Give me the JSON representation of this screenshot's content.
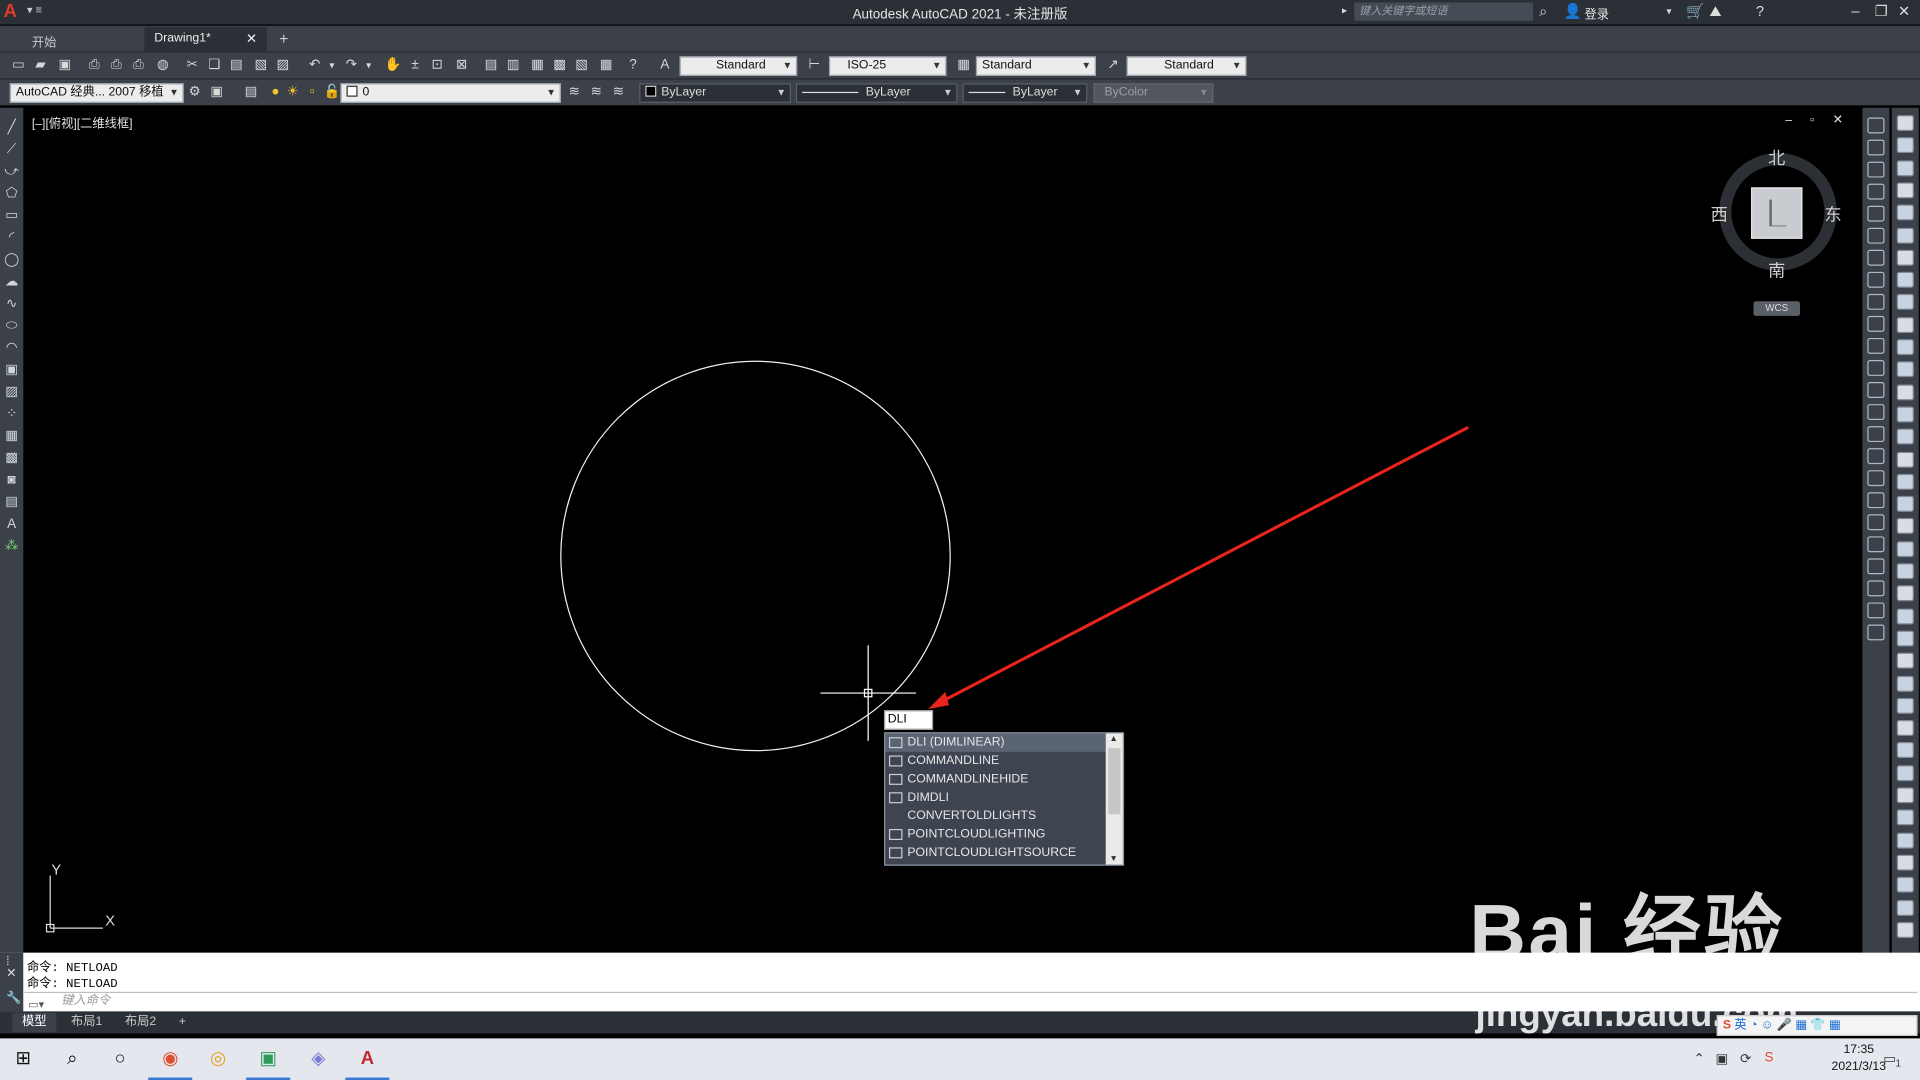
{
  "titlebar": {
    "title": "Autodesk AutoCAD 2021 - 未注册版",
    "search_placeholder": "键入关键字或短语",
    "login_label": "登录",
    "help_label": "?"
  },
  "doc_tabs": {
    "start_label": "开始",
    "drawing_label": "Drawing1*",
    "close_glyph": "✕",
    "add_glyph": "+"
  },
  "toolbar1": {
    "text_style": "Standard",
    "dim_style": "ISO-25",
    "table_style": "Standard",
    "mleader_style": "Standard"
  },
  "toolbar2": {
    "workspace": "AutoCAD 经典... 2007 移植",
    "layer": "0",
    "color": "ByLayer",
    "linetype": "ByLayer",
    "lineweight": "ByLayer",
    "plotstyle": "ByColor"
  },
  "viewport": {
    "label": "[–][俯视][二维线框]",
    "controls": "– ▫ ✕"
  },
  "viewcube": {
    "north": "北",
    "south": "南",
    "east": "东",
    "west": "西",
    "wcs": "WCS"
  },
  "ucs": {
    "y": "Y",
    "x": "X"
  },
  "command_input": {
    "value": "DLI"
  },
  "autocomplete": {
    "items": [
      {
        "label": "DLI (DIMLINEAR)",
        "icon": "dimlinear-icon"
      },
      {
        "label": "COMMANDLINE",
        "icon": "commandline-icon"
      },
      {
        "label": "COMMANDLINEHIDE",
        "icon": "commandlinehide-icon"
      },
      {
        "label": "DIMDLI",
        "icon": "sysvar-icon"
      },
      {
        "label": "CONVERTOLDLIGHTS",
        "icon": ""
      },
      {
        "label": "POINTCLOUDLIGHTING",
        "icon": "sysvar-icon"
      },
      {
        "label": "POINTCLOUDLIGHTSOURCE",
        "icon": "sysvar-icon"
      }
    ]
  },
  "command_history": [
    "命令:  NETLOAD",
    "命令: NETLOAD"
  ],
  "command_line": {
    "placeholder": "键入命令"
  },
  "layout_tabs": [
    "模型",
    "布局1",
    "布局2"
  ],
  "layout_add": "+",
  "watermark": {
    "brand": "Bai 经验",
    "url": "jingyan.baidu.com"
  },
  "taskbar": {
    "time": "17:35",
    "date": "2021/3/13",
    "ime_label": "英",
    "notification_count": "1"
  },
  "colors": {
    "arrow": "#e8241c",
    "circle": "#ffffff",
    "canvas": "#000000",
    "ui_dark": "#3b4049"
  }
}
